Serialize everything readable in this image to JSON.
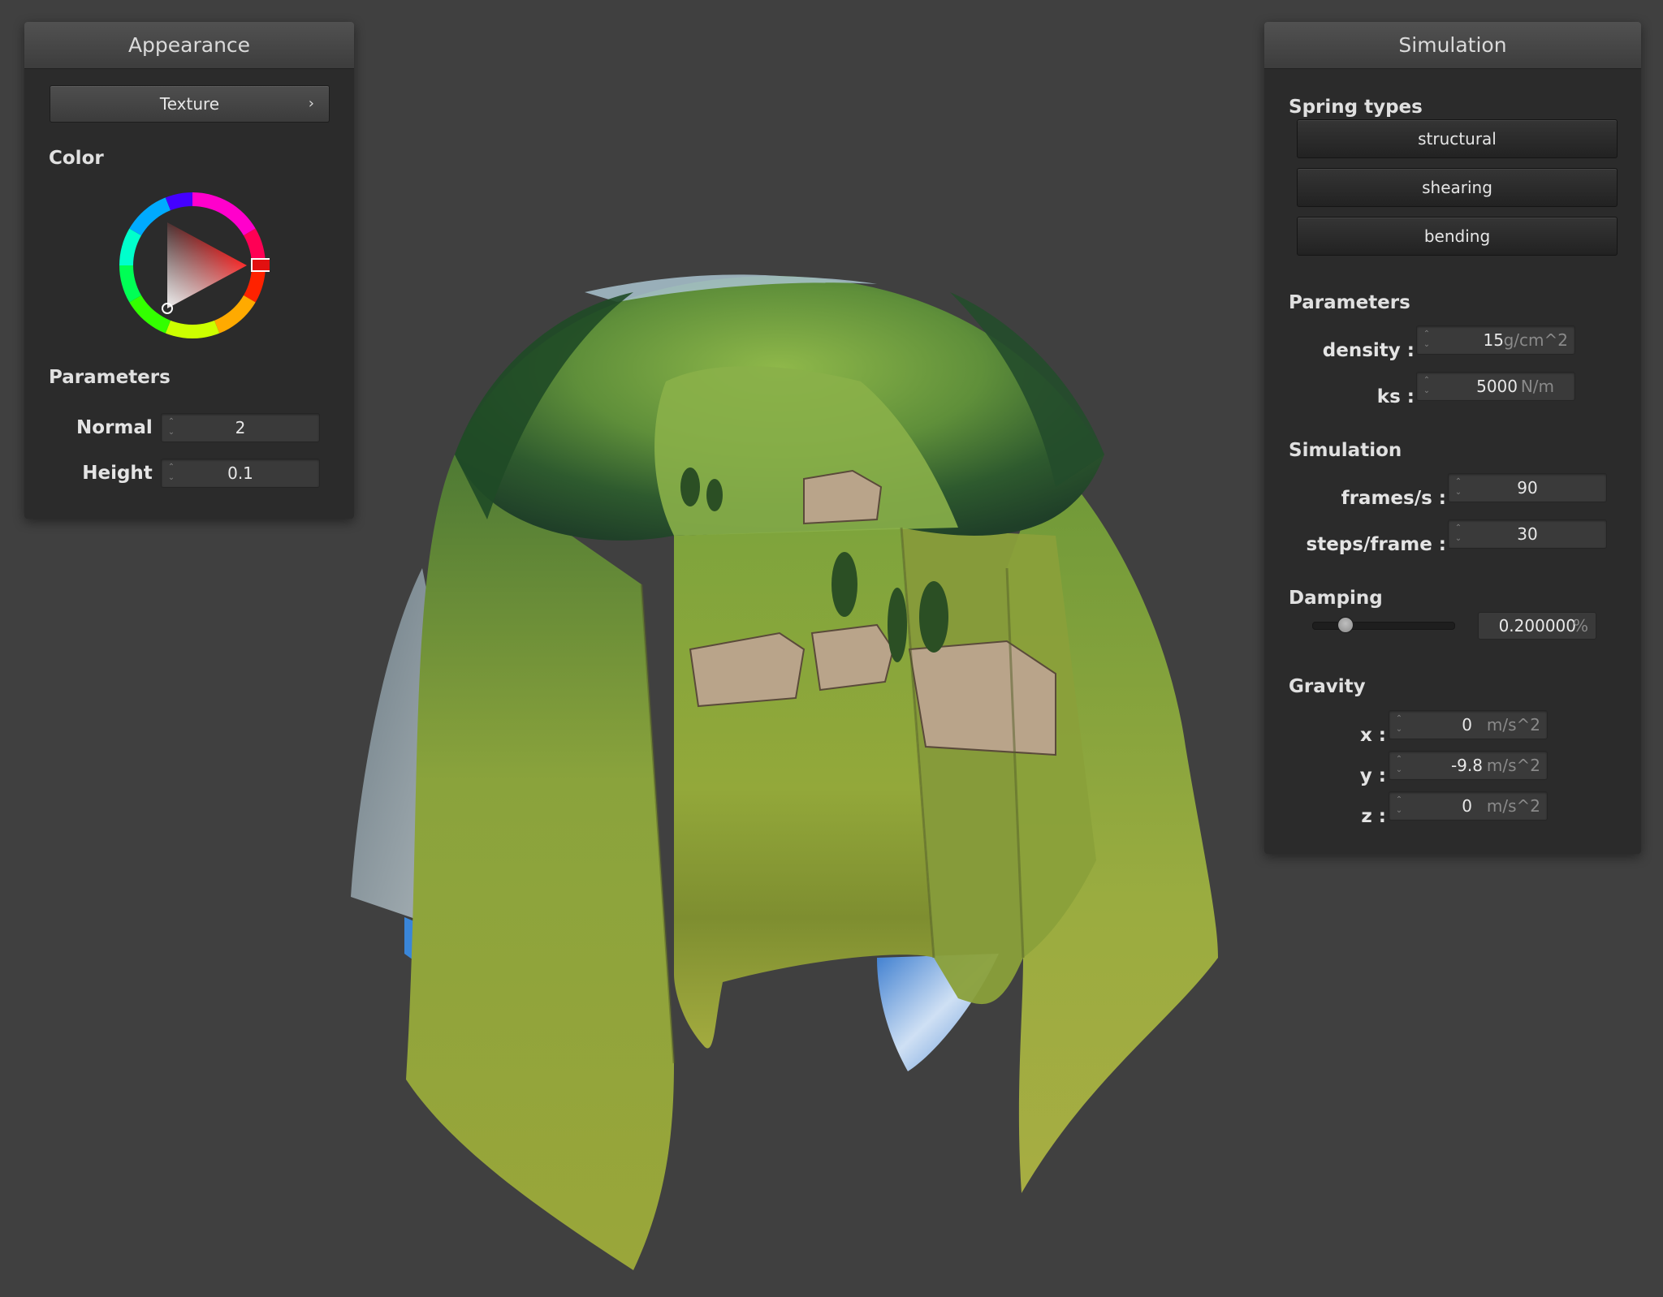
{
  "appearance": {
    "title": "Appearance",
    "texture_button": {
      "label": "Texture",
      "chevron": "›"
    },
    "color_label": "Color",
    "color_wheel": {
      "selected_hue": "#ff0000",
      "ring": "hsv-ring",
      "triangle": "sv-triangle"
    },
    "parameters_label": "Parameters",
    "normal": {
      "label": "Normal :",
      "value": "2"
    },
    "height": {
      "label": "Height :",
      "value": "0.1"
    }
  },
  "simulation": {
    "title": "Simulation",
    "spring_types_label": "Spring types",
    "spring_buttons": [
      "structural",
      "shearing",
      "bending"
    ],
    "parameters_label": "Parameters",
    "density": {
      "label": "density :",
      "value": "15",
      "unit": "g/cm^2"
    },
    "ks": {
      "label": "ks :",
      "value": "5000",
      "unit": "N/m"
    },
    "simulation_label": "Simulation",
    "fps": {
      "label": "frames/s :",
      "value": "90"
    },
    "steps": {
      "label": "steps/frame :",
      "value": "30"
    },
    "damping_label": "Damping",
    "damping": {
      "slider_level": 0.2,
      "value": "0.200000",
      "unit": "%"
    },
    "gravity_label": "Gravity",
    "gravity": [
      {
        "label": "x :",
        "value": "0",
        "unit": "m/s^2"
      },
      {
        "label": "y :",
        "value": "-9.8",
        "unit": "m/s^2"
      },
      {
        "label": "z :",
        "value": "0",
        "unit": "m/s^2"
      }
    ]
  },
  "viewport": {
    "background": "#404040",
    "object": "textured-cloth-mesh"
  }
}
